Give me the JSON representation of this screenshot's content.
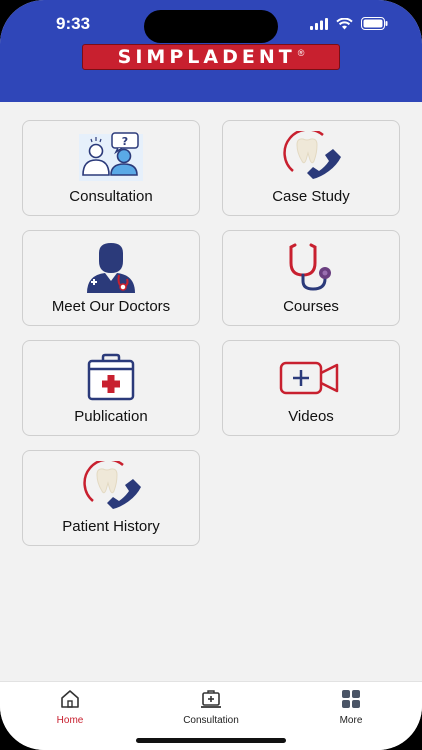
{
  "status": {
    "time": "9:33"
  },
  "header": {
    "logo_text": "SIMPLADENT",
    "logo_mark": "®"
  },
  "menu": [
    {
      "label": "Consultation",
      "icon": "consultation-icon"
    },
    {
      "label": "Case Study",
      "icon": "dental-phone-icon"
    },
    {
      "label": "Meet Our Doctors",
      "icon": "doctor-icon"
    },
    {
      "label": "Courses",
      "icon": "stethoscope-icon"
    },
    {
      "label": "Publication",
      "icon": "first-aid-kit-icon"
    },
    {
      "label": "Videos",
      "icon": "video-camera-icon"
    },
    {
      "label": "Patient History",
      "icon": "dental-phone-icon"
    }
  ],
  "tabs": [
    {
      "label": "Home",
      "icon": "home-icon",
      "active": true
    },
    {
      "label": "Consultation",
      "icon": "consultation-tab-icon",
      "active": false
    },
    {
      "label": "More",
      "icon": "grid-icon",
      "active": false
    }
  ],
  "colors": {
    "header_blue": "#2f46b8",
    "brand_red": "#c8202f",
    "navy": "#2b3a7a",
    "tooth": "#efe8d8",
    "background": "#f2f2f2"
  }
}
